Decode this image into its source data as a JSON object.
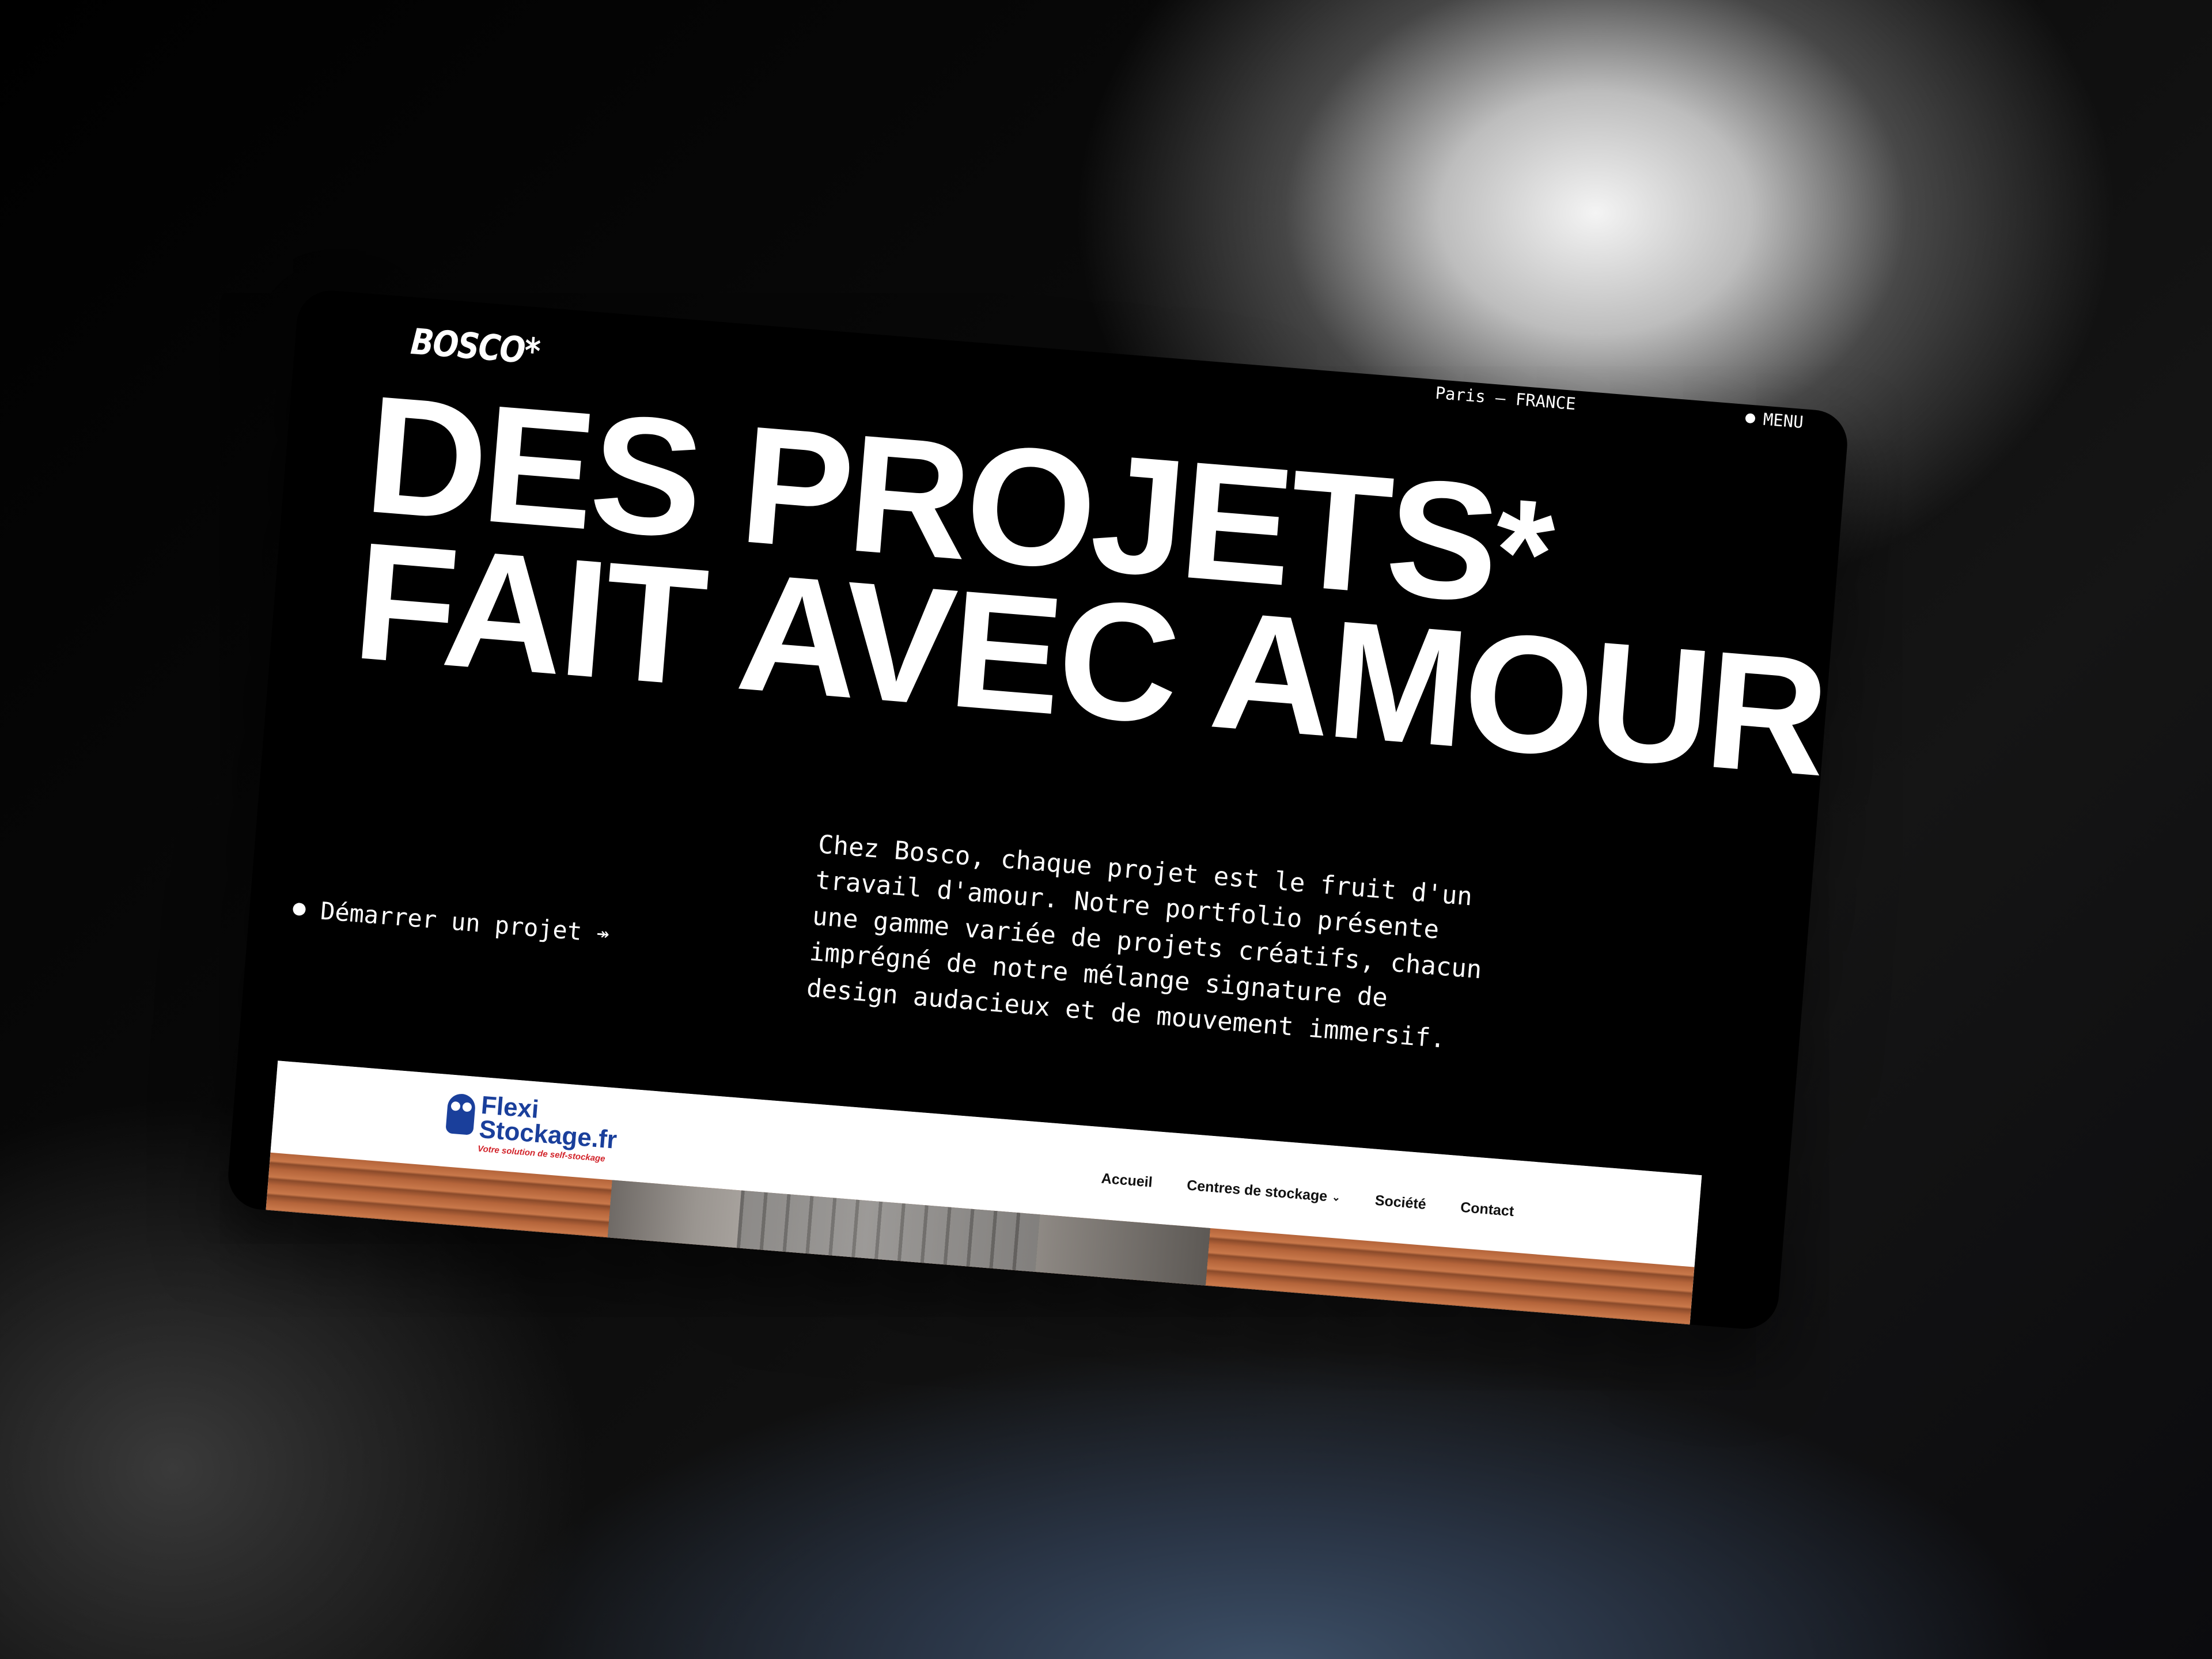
{
  "header": {
    "logo": "BOSCO*",
    "location": "Paris — FRANCE",
    "menu_label": "MENU"
  },
  "hero": {
    "title_line1": "DES PROJETS",
    "title_star": "*",
    "title_line2": "FAIT AVEC AMOUR",
    "cta_label": "Démarrer un projet",
    "cta_arrow": "↠",
    "description": "Chez Bosco, chaque projet est le fruit d'un travail d'amour. Notre portfolio présente une gamme variée de projets créatifs, chacun imprégné de notre mélange signature de design audacieux et de mouvement immersif."
  },
  "preview": {
    "brand_name_line1": "Flexi",
    "brand_name_line2": "Stockage.fr",
    "brand_tagline": "Votre solution de self-stockage",
    "nav": [
      {
        "label": "Accueil"
      },
      {
        "label": "Centres de stockage",
        "icon": "chevron-down-icon"
      },
      {
        "label": "Société"
      },
      {
        "label": "Contact"
      }
    ]
  },
  "colors": {
    "background": "#000000",
    "text": "#ffffff",
    "flexi_blue": "#1a3f9b",
    "flexi_red": "#d2232a"
  }
}
